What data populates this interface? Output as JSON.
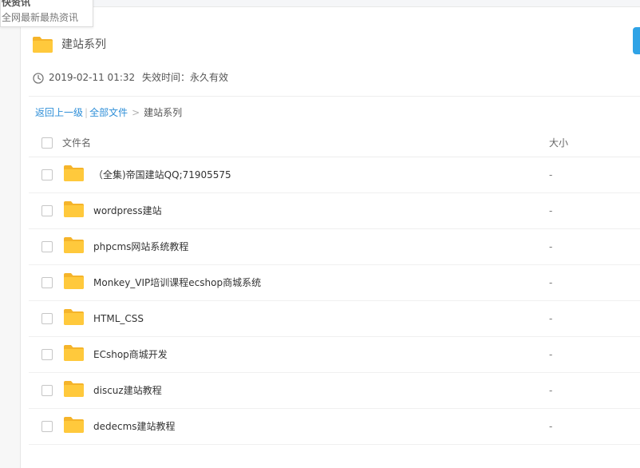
{
  "tooltip": {
    "title": "快资讯",
    "subtitle": "全网最新最热资讯"
  },
  "header": {
    "title": "建站系列",
    "icon": "folder-icon"
  },
  "meta": {
    "date": "2019-02-11 01:32",
    "expire": "失效时间：永久有效",
    "icon": "clock-icon"
  },
  "breadcrumb": {
    "back": "返回上一级",
    "separator": "|",
    "all_files": "全部文件",
    "arrow": ">",
    "current": "建站系列"
  },
  "table": {
    "col_name": "文件名",
    "col_size": "大小",
    "rows": [
      {
        "name": "（全集)帝国建站QQ;71905575",
        "size": "-"
      },
      {
        "name": "wordpress建站",
        "size": "-"
      },
      {
        "name": "phpcms网站系统教程",
        "size": "-"
      },
      {
        "name": "Monkey_VIP培训课程ecshop商城系统",
        "size": "-"
      },
      {
        "name": "HTML_CSS",
        "size": "-"
      },
      {
        "name": "ECshop商城开发",
        "size": "-"
      },
      {
        "name": "discuz建站教程",
        "size": "-"
      },
      {
        "name": "dedecms建站教程",
        "size": "-"
      }
    ]
  },
  "colors": {
    "folder": "#ffc93c",
    "folder_tab": "#f5b42a",
    "link": "#2f8fd8",
    "accent_button": "#2fa3e6"
  }
}
